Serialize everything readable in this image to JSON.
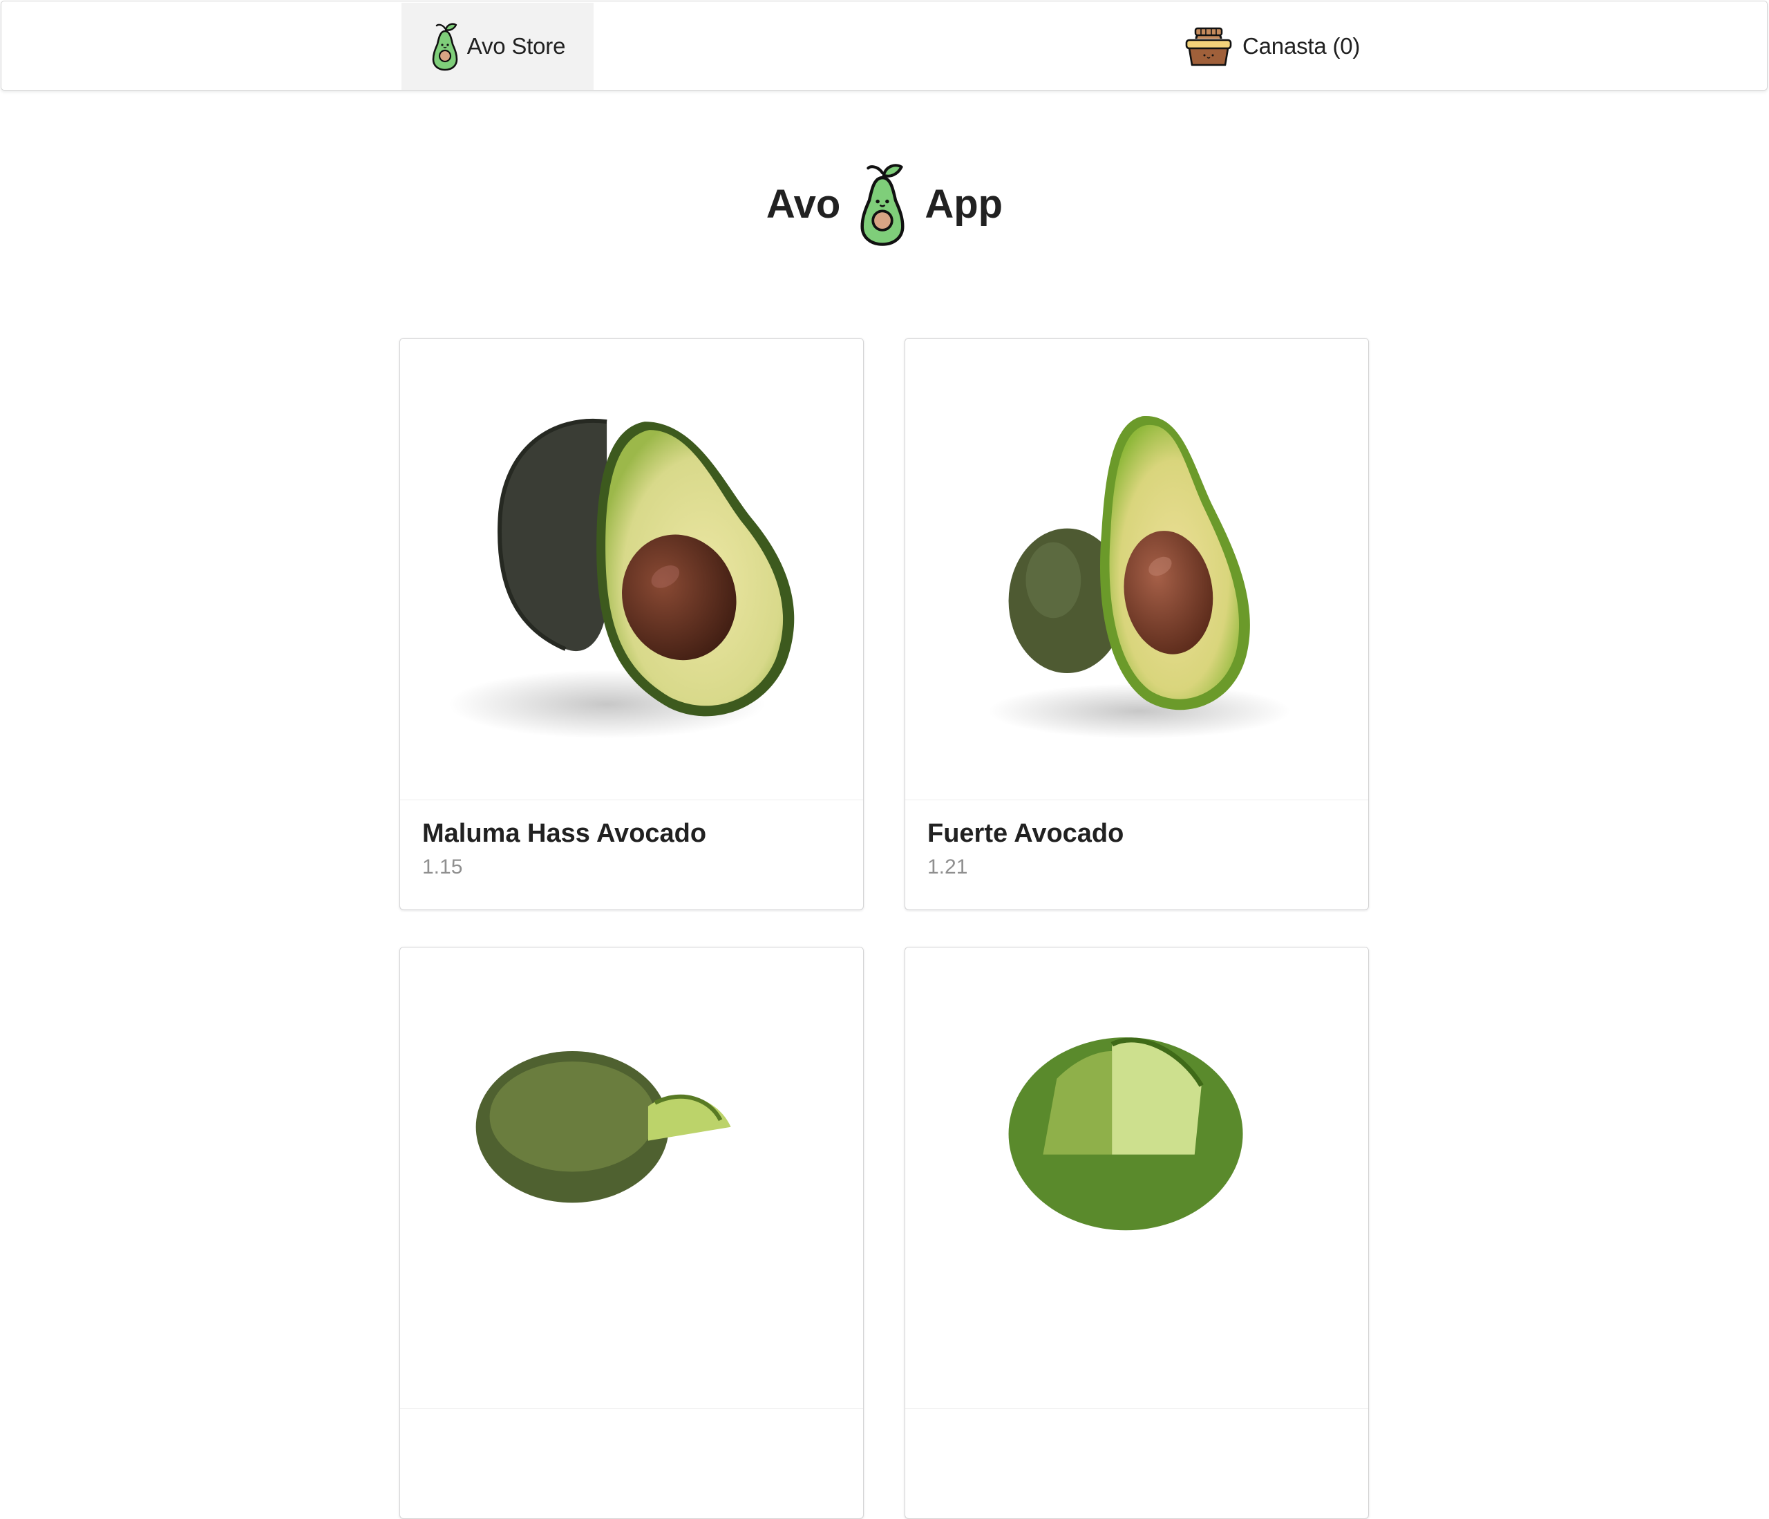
{
  "nav": {
    "brand_label": "Avo Store",
    "cart_label": "Canasta (0)"
  },
  "hero": {
    "word_left": "Avo",
    "word_right": "App"
  },
  "products": [
    {
      "name": "Maluma Hass Avocado",
      "price": "1.15"
    },
    {
      "name": "Fuerte Avocado",
      "price": "1.21"
    },
    {
      "name": "",
      "price": ""
    },
    {
      "name": "",
      "price": ""
    }
  ],
  "icons": {
    "brand": "avocado-mascot-icon",
    "cart": "basket-icon"
  },
  "colors": {
    "avocado_green": "#7fce7a",
    "pit_brown": "#c8977a",
    "basket_brown": "#a0603a",
    "price_gray": "#8f8f8f",
    "nav_active_bg": "#f2f2f2"
  }
}
